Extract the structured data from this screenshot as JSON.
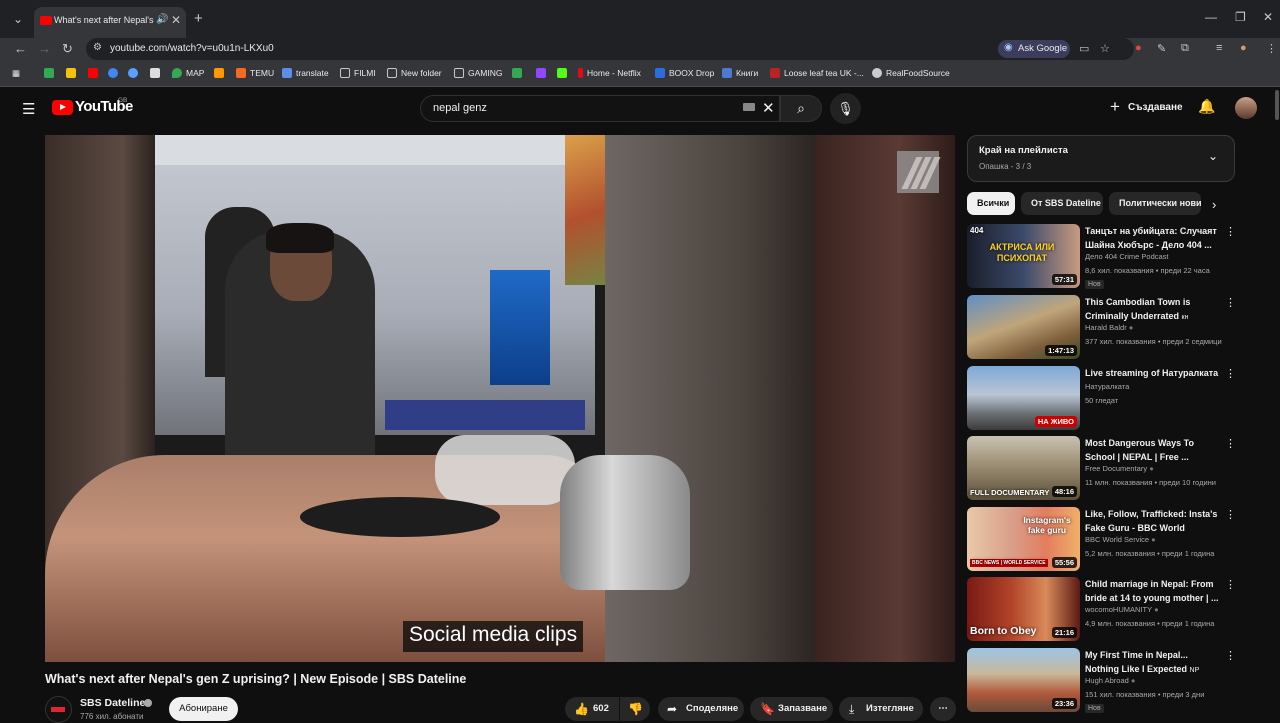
{
  "browser": {
    "tab_title": "What's next after Nepal's ge",
    "url": "youtube.com/watch?v=u0u1n-LKXu0",
    "ask_google": "Ask Google",
    "bookmarks": [
      "MAP",
      "TEMU",
      "translate",
      "FILMI",
      "New folder",
      "GAMING",
      "Home - Netflix",
      "BOOX Drop",
      "Книги",
      "Loose leaf tea UK -...",
      "RealFoodSource"
    ]
  },
  "masthead": {
    "logo": "YouTube",
    "region": "GB",
    "search_query": "nepal genz",
    "create_label": "Създаване"
  },
  "player": {
    "caption": "Social media clips"
  },
  "video": {
    "title": "What's next after Nepal's gen Z uprising? | New Episode | SBS Dateline",
    "channel": "SBS Dateline",
    "subscribers": "776 хил. абонати",
    "subscribe_label": "Абониране",
    "likes": "602",
    "share_label": "Споделяне",
    "save_label": "Запазване",
    "download_label": "Изтегляне"
  },
  "playlist": {
    "title": "Край на плейлиста",
    "subtitle": "Опашка - 3 / 3"
  },
  "chips": [
    "Всички",
    "От SBS Dateline",
    "Политически нови"
  ],
  "recommendations": [
    {
      "title": "Танцът на убийцата: Случаят Шайна Хюбърс - Дело 404 ...",
      "channel": "Дело 404 Crime Podcast",
      "meta": "8,6 хил. показвания • преди 22 часа",
      "badge": "Нов",
      "duration": "57:31",
      "overlay_top": "404",
      "overlay_main": "АКТРИСА ИЛИ ПСИХОПАТ"
    },
    {
      "title": "This Cambodian Town is Criminally Underrated",
      "title_suffix": "кн",
      "channel": "Harald Baldr",
      "meta": "377 хил. показвания • преди 2 седмици",
      "duration": "1:47:13"
    },
    {
      "title": "Live streaming of Натуралката",
      "channel": "Натуралката",
      "meta": "50 гледат",
      "live": "НА ЖИВО"
    },
    {
      "title": "Most Dangerous Ways To School | NEPAL | Free ...",
      "channel": "Free Documentary",
      "meta": "11 млн. показвания • преди 10 години",
      "duration": "48:16",
      "overlay_main": "FULL DOCUMENTARY"
    },
    {
      "title": "Like, Follow, Trafficked: Insta's Fake Guru - BBC World Service...",
      "channel": "BBC World Service",
      "meta": "5,2 млн. показвания • преди 1 година",
      "duration": "55:56",
      "overlay_main": "Instagram's fake guru",
      "overlay_bottom": "BBC NEWS | WORLD SERVICE"
    },
    {
      "title": "Child marriage in Nepal: From bride at 14 to young mother | ...",
      "channel": "wocomoHUMANITY",
      "meta": "4,9 млн. показвания • преди 1 година",
      "duration": "21:16",
      "overlay_main": "Born to Obey"
    },
    {
      "title": "My First Time in Nepal... Nothing Like I Expected",
      "title_suffix": "NP",
      "channel": "Hugh Abroad",
      "meta": "151 хил. показвания • преди 3 дни",
      "badge": "Нов",
      "duration": "23:36"
    }
  ],
  "colors": {
    "background": "#0f0f0f",
    "brand_red": "#ff0000",
    "live_red": "#cc0000",
    "chrome_dark": "#202124"
  }
}
